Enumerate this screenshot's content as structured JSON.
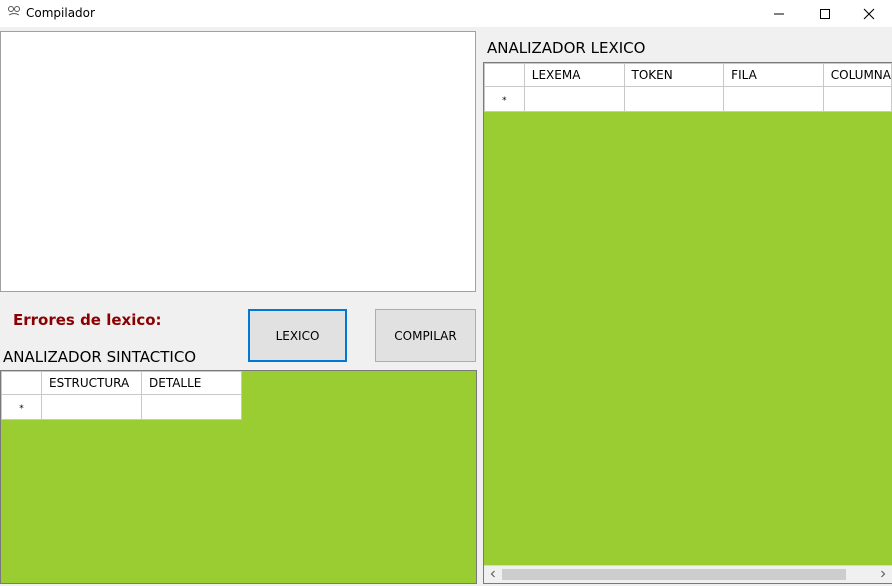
{
  "window": {
    "title": "Compilador",
    "app_icon": "compiler-icon",
    "controls": {
      "minimize": "minimize-icon",
      "maximize": "maximize-icon",
      "close": "close-icon"
    }
  },
  "editor": {
    "value": ""
  },
  "errors": {
    "label": "Errores de lexico:"
  },
  "buttons": {
    "lexico": "LEXICO",
    "compilar": "COMPILAR"
  },
  "sintactico": {
    "title": "ANALIZADOR SINTACTICO",
    "columns": [
      "ESTRUCTURA",
      "DETALLE"
    ],
    "new_row_marker": "*"
  },
  "lexico": {
    "title": "ANALIZADOR LEXICO",
    "columns": [
      "LEXEMA",
      "TOKEN",
      "FILA",
      "COLUMNA"
    ],
    "new_row_marker": "*",
    "scroll_left_icon": "chevron-left-icon",
    "scroll_right_icon": "chevron-right-icon"
  },
  "colors": {
    "grid_background": "#9acd32",
    "error_label": "#8b0000",
    "focus_border": "#0078d7"
  }
}
